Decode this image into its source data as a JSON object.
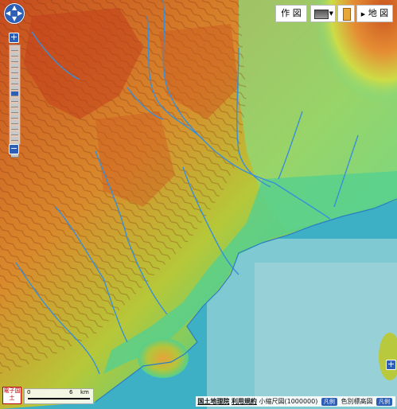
{
  "toolbar": {
    "draw_label": "作 図",
    "map_label": "地 図",
    "play_symbol": "▶"
  },
  "nav": {
    "zoom_in": "+",
    "zoom_out": "−",
    "right_zoom_in": "+",
    "right_zoom_out": "−"
  },
  "scale": {
    "zero": "0",
    "distance": "6",
    "unit": "km"
  },
  "logo_text": "電子国土",
  "attribution": {
    "gsi": "国土地理院",
    "terms": "利用規約",
    "map_name": "小縮尺図(1000000)",
    "legend1": "凡例",
    "layer_name": "色別標高図",
    "legend2": "凡例"
  },
  "colors": {
    "sea": "#3ba9c2",
    "lowland": "#6ed89a",
    "hills": "#d9c83a",
    "mountain": "#d45a22",
    "river": "#3a8fd8",
    "control_blue": "#2d5fb6"
  }
}
